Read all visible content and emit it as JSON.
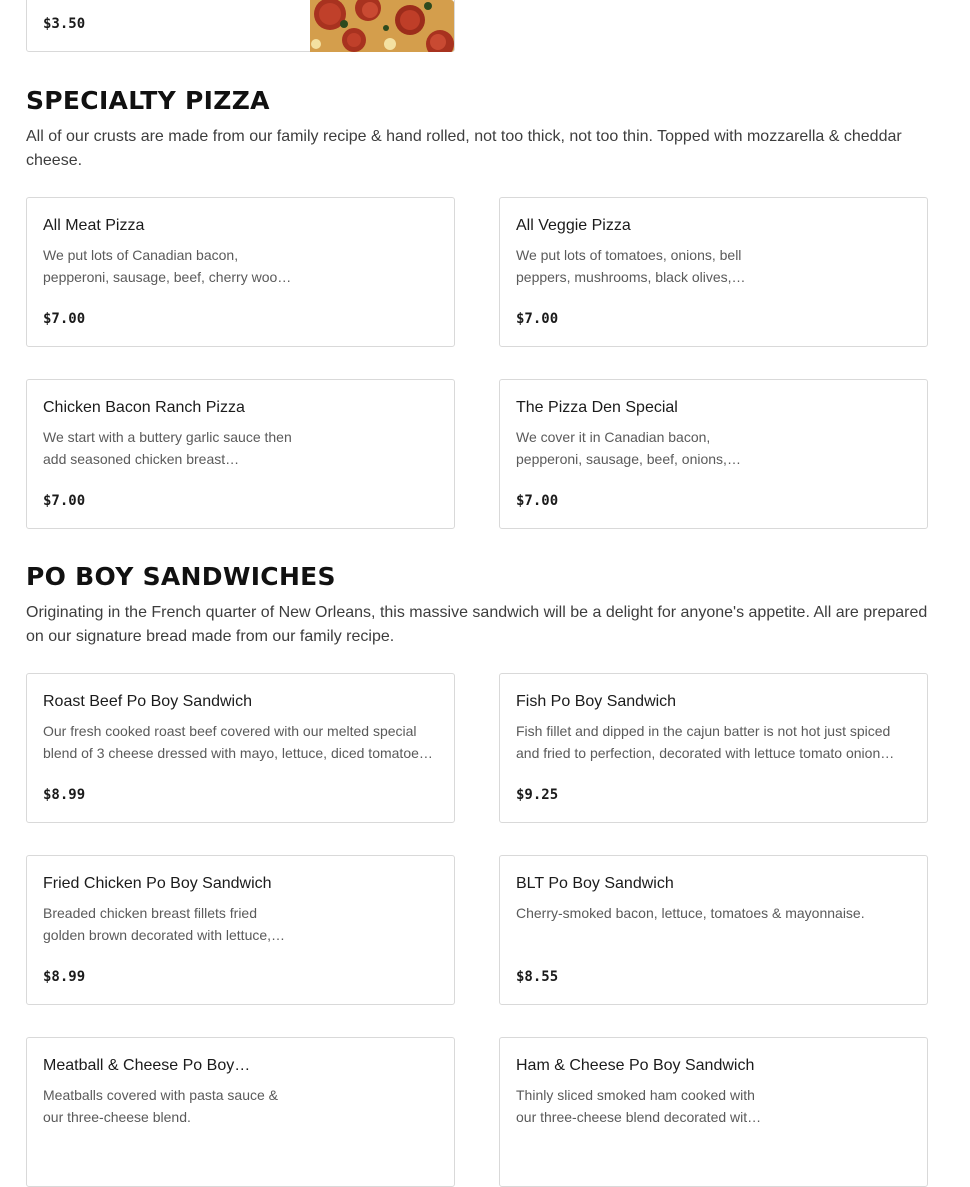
{
  "top_card": {
    "price": "$3.50",
    "image_alt": "pepperoni pizza photo"
  },
  "sections": {
    "specialty": {
      "title": "SPECIALTY PIZZA",
      "description": "All of our crusts are made from our family recipe & hand rolled, not too thick, not too thin. Topped with mozzarella & cheddar cheese.",
      "items": [
        {
          "name": "All Meat Pizza",
          "description": "We put lots of Canadian bacon, pepperoni, sausage, beef, cherry woo…",
          "price": "$7.00"
        },
        {
          "name": "All Veggie Pizza",
          "description": "We put lots of tomatoes, onions, bell peppers, mushrooms, black olives,…",
          "price": "$7.00"
        },
        {
          "name": "Chicken Bacon Ranch Pizza",
          "description": "We start with a buttery garlic sauce then add seasoned chicken breast…",
          "price": "$7.00"
        },
        {
          "name": "The Pizza Den Special",
          "description": "We cover it in Canadian bacon, pepperoni, sausage, beef, onions, bell…",
          "price": "$7.00"
        }
      ]
    },
    "poboy": {
      "title": "PO BOY SANDWICHES",
      "description": "Originating in the French quarter of New Orleans, this massive sandwich will be a delight for anyone's appetite. All are prepared on our signature bread made from our family recipe.",
      "items": [
        {
          "name": "Roast Beef Po Boy Sandwich",
          "description": "Our fresh cooked roast beef covered with our melted special blend of 3 cheese dressed with mayo, lettuce, diced tomatoe…",
          "price": "$8.99"
        },
        {
          "name": "Fish Po Boy Sandwich",
          "description": "Fish fillet and dipped in the cajun batter is not hot just spiced and fried to perfection, decorated with lettuce tomato onion…",
          "price": "$9.25"
        },
        {
          "name": "Fried Chicken Po Boy Sandwich",
          "description": "Breaded chicken breast fillets fried golden brown decorated with lettuce,…",
          "price": "$8.99"
        },
        {
          "name": "BLT Po Boy Sandwich",
          "description": "Cherry-smoked bacon, lettuce, tomatoes & mayonnaise.",
          "price": "$8.55"
        },
        {
          "name": "Meatball & Cheese Po Boy…",
          "description": "Meatballs covered with pasta sauce & our three-cheese blend.",
          "price": ""
        },
        {
          "name": "Ham & Cheese Po Boy Sandwich",
          "description": "Thinly sliced smoked ham cooked with our three-cheese blend decorated wit…",
          "price": ""
        }
      ]
    }
  }
}
